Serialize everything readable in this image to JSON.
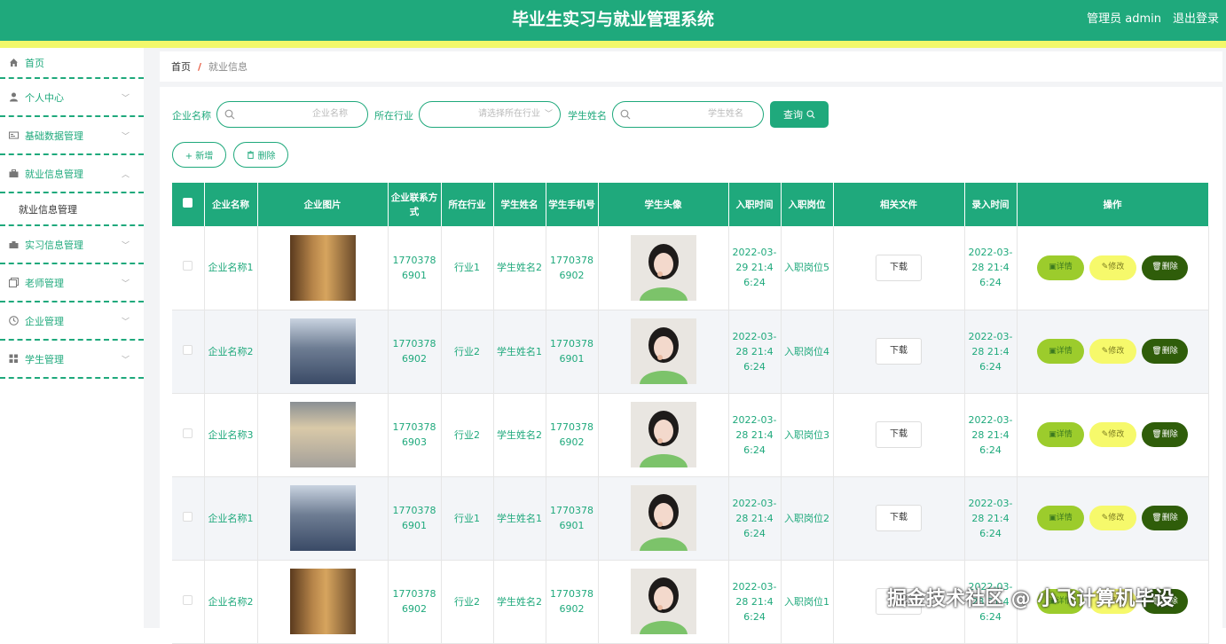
{
  "header": {
    "title": "毕业生实习与就业管理系统",
    "admin": "管理员 admin",
    "logout": "退出登录"
  },
  "sidebar": {
    "items": [
      {
        "label": "首页",
        "icon": "home-icon"
      },
      {
        "label": "个人中心",
        "icon": "user-icon"
      },
      {
        "label": "基础数据管理",
        "icon": "id-card-icon"
      },
      {
        "label": "就业信息管理",
        "icon": "briefcase-icon",
        "expanded": true
      },
      {
        "label": "实习信息管理",
        "icon": "toolbox-icon"
      },
      {
        "label": "老师管理",
        "icon": "copy-icon"
      },
      {
        "label": "企业管理",
        "icon": "clock-icon"
      },
      {
        "label": "学生管理",
        "icon": "grid-icon"
      }
    ],
    "sub": {
      "label": "就业信息管理"
    }
  },
  "breadcrumb": {
    "home": "首页",
    "sep": "/",
    "current": "就业信息"
  },
  "filters": {
    "company_label": "企业名称",
    "company_placeholder": "企业名称",
    "industry_label": "所在行业",
    "industry_placeholder": "请选择所在行业",
    "student_label": "学生姓名",
    "student_placeholder": "学生姓名",
    "query": "查询"
  },
  "actions": {
    "add": "+ 新增",
    "delete": "删除"
  },
  "table": {
    "headers": [
      "企业名称",
      "企业图片",
      "企业联系方式",
      "所在行业",
      "学生姓名",
      "学生手机号",
      "学生头像",
      "入职时间",
      "入职岗位",
      "相关文件",
      "录入时间",
      "操作"
    ],
    "download": "下载",
    "op_detail": "详情",
    "op_edit": "修改",
    "op_delete": "删除",
    "rows": [
      {
        "company": "企业名称1",
        "phone": "17703786901",
        "industry": "行业1",
        "student": "学生姓名2",
        "student_phone": "17703786902",
        "join_time": "2022-03-29 21:46:24",
        "position": "入职岗位5",
        "created": "2022-03-28 21:46:24"
      },
      {
        "company": "企业名称2",
        "phone": "17703786902",
        "industry": "行业2",
        "student": "学生姓名1",
        "student_phone": "17703786901",
        "join_time": "2022-03-28 21:46:24",
        "position": "入职岗位4",
        "created": "2022-03-28 21:46:24"
      },
      {
        "company": "企业名称3",
        "phone": "17703786903",
        "industry": "行业2",
        "student": "学生姓名2",
        "student_phone": "17703786902",
        "join_time": "2022-03-28 21:46:24",
        "position": "入职岗位3",
        "created": "2022-03-28 21:46:24"
      },
      {
        "company": "企业名称1",
        "phone": "17703786901",
        "industry": "行业1",
        "student": "学生姓名1",
        "student_phone": "17703786901",
        "join_time": "2022-03-28 21:46:24",
        "position": "入职岗位2",
        "created": "2022-03-28 21:46:24"
      },
      {
        "company": "企业名称2",
        "phone": "17703786902",
        "industry": "行业2",
        "student": "学生姓名2",
        "student_phone": "17703786902",
        "join_time": "2022-03-28 21:46:24",
        "position": "入职岗位1",
        "created": "2022-03-28 21:46:24"
      }
    ]
  },
  "watermark": "掘金技术社区 @ 小飞计算机毕设",
  "colors": {
    "primary": "#1fa97c",
    "stripe": "#f2f86a",
    "detail": "#9ccc2c",
    "edit": "#f6f96b",
    "delete": "#2f5d0a"
  }
}
